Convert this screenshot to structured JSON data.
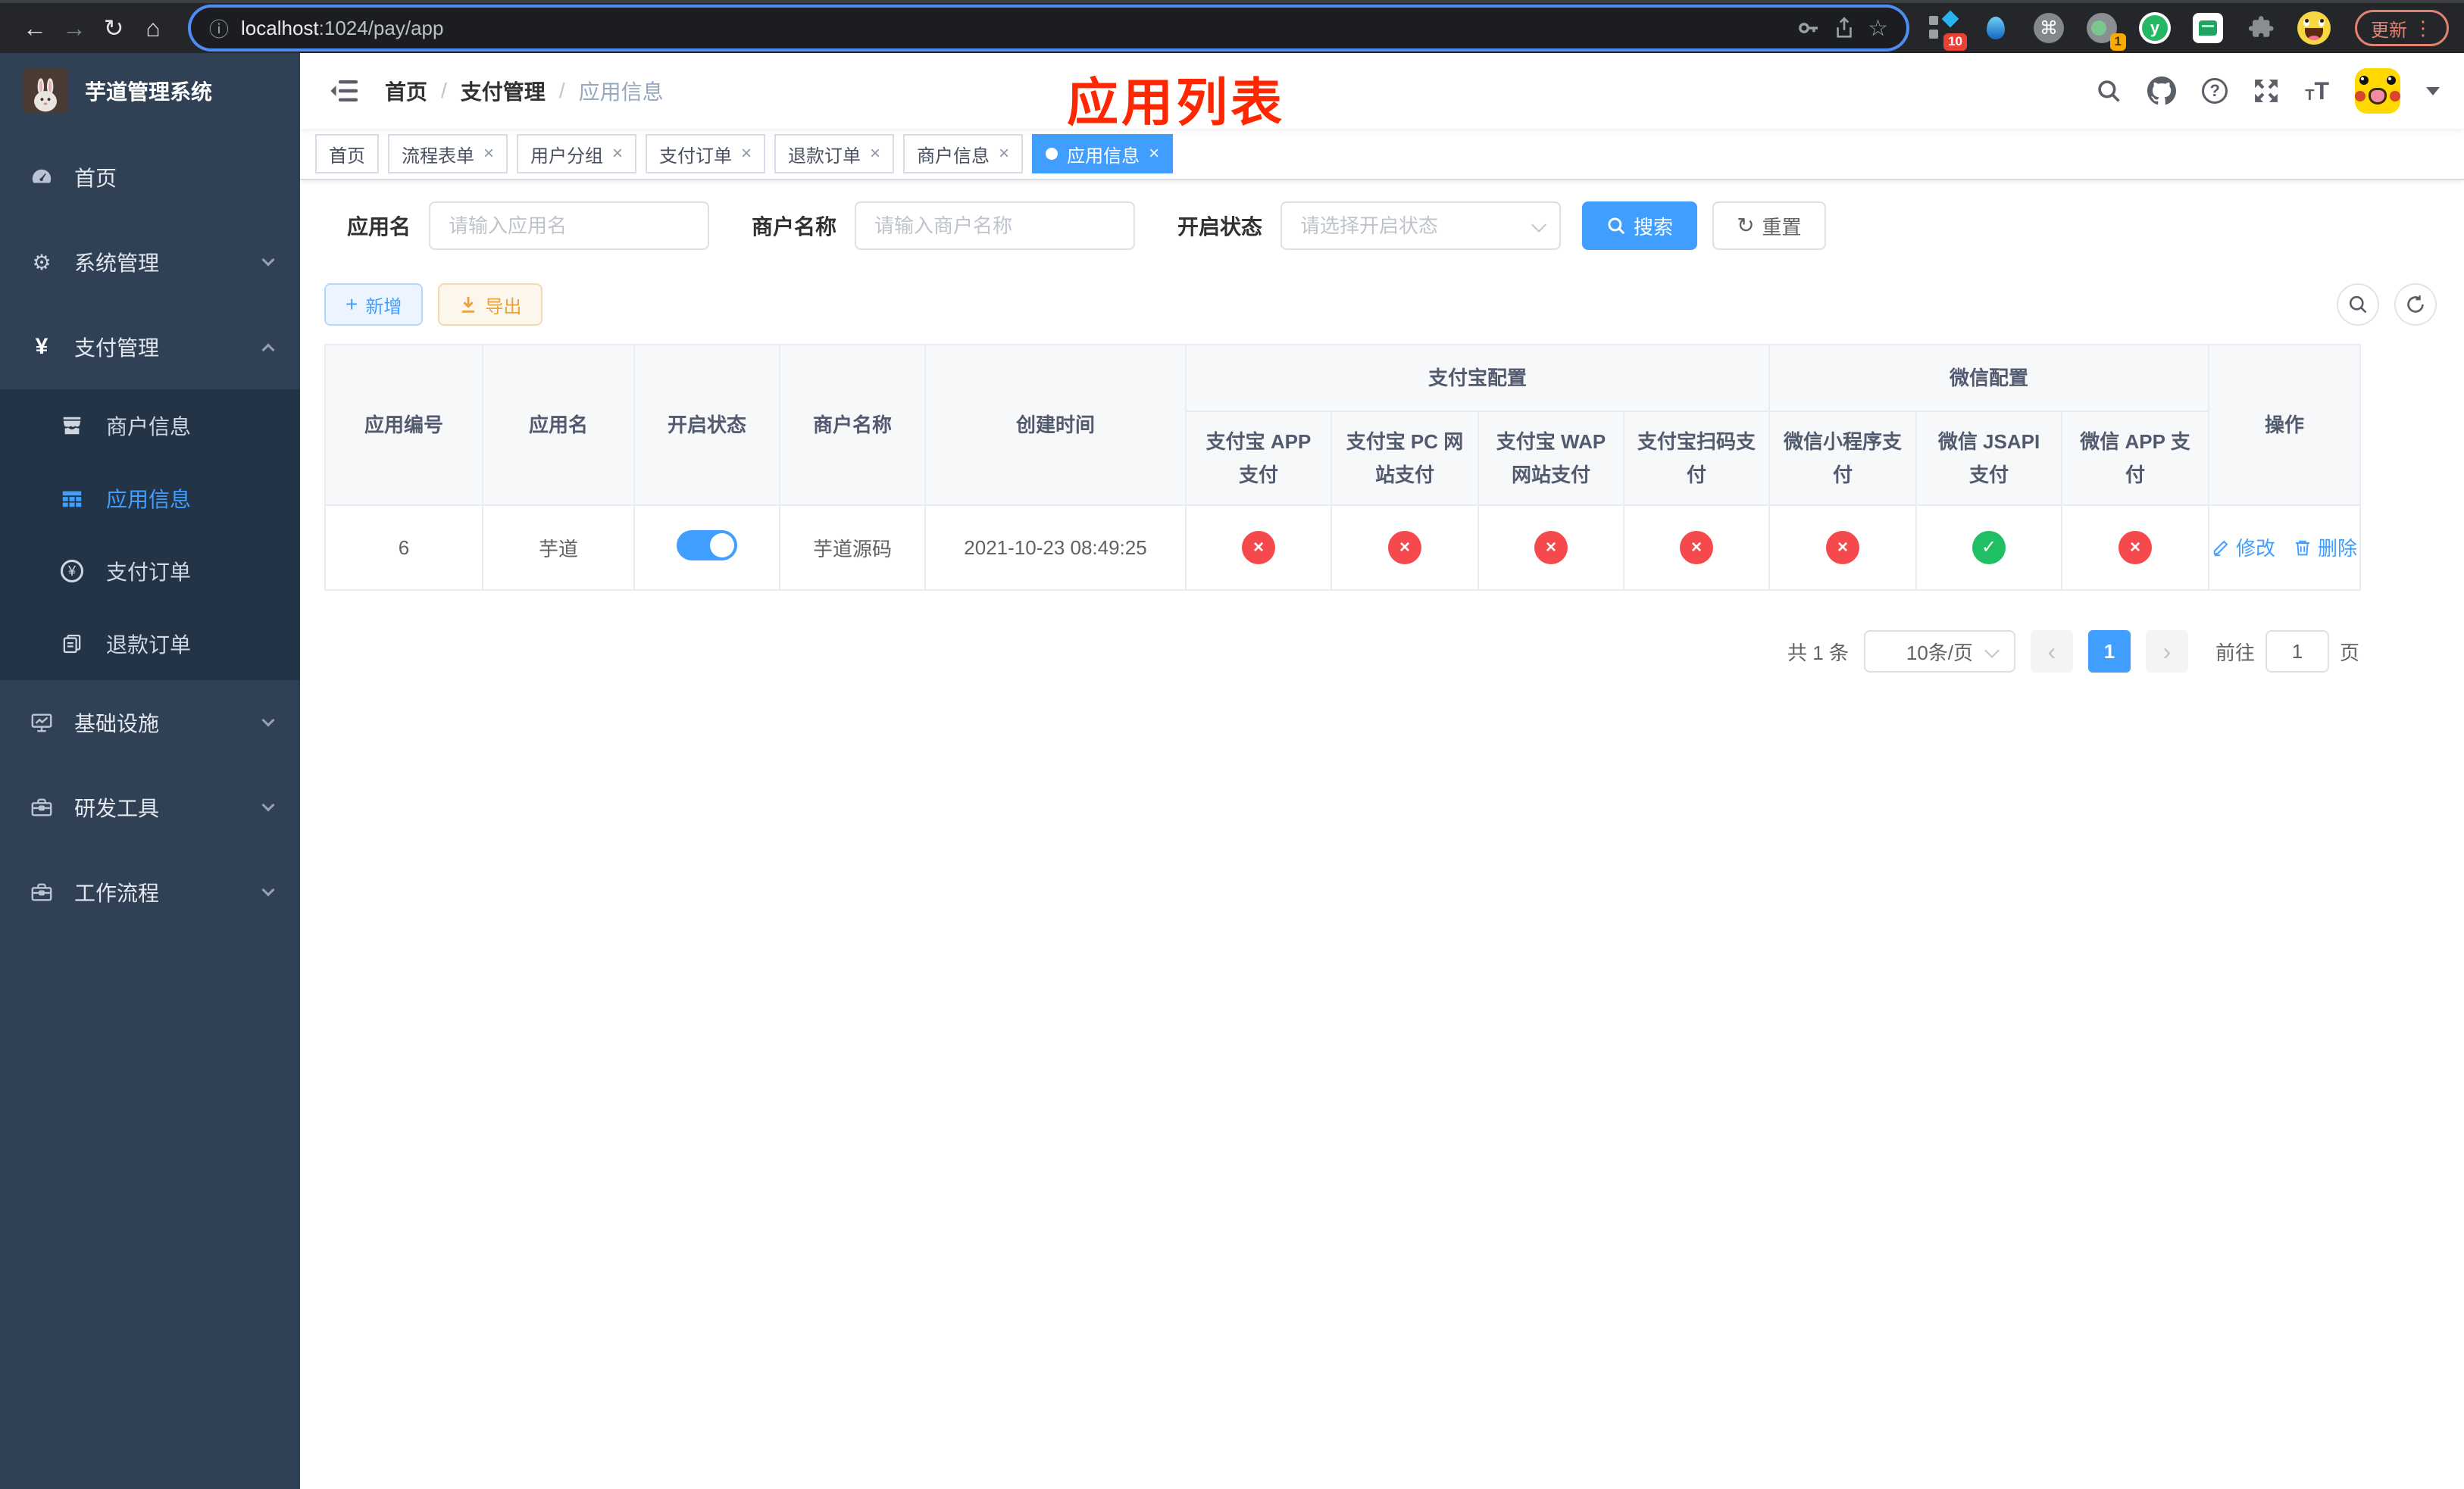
{
  "colors": {
    "accent": "#409eff",
    "danger": "#f5494d",
    "success": "#21bf63",
    "warning": "#e6a23c",
    "annotation_red": "#ff2600",
    "sidebar_bg": "#304156"
  },
  "icons": {
    "back": "←",
    "forward": "→",
    "reload": "↻",
    "home": "⌂",
    "info": "ⓘ",
    "star": "☆",
    "command": "⌘",
    "kebab": "⋮",
    "help": "?",
    "font_small": "T",
    "font_large": "T",
    "check": "✓",
    "cross": "×",
    "prev": "‹",
    "next": "›",
    "yuan": "¥",
    "plus": "+",
    "close": "×"
  },
  "browser": {
    "url_host": "localhost",
    "url_path": ":1024/pay/app",
    "update_label": "更新",
    "ext_badge_count": "10",
    "ext_circle_count": "1",
    "ext_y_label": "y"
  },
  "sidebar": {
    "title": "芋道管理系统",
    "home": "首页",
    "system": "系统管理",
    "payment": "支付管理",
    "merchant_info": "商户信息",
    "app_info": "应用信息",
    "pay_order": "支付订单",
    "refund_order": "退款订单",
    "infrastructure": "基础设施",
    "dev_tools": "研发工具",
    "workflow": "工作流程"
  },
  "breadcrumb": {
    "home": "首页",
    "section": "支付管理",
    "current": "应用信息"
  },
  "annotation": {
    "title": "应用列表"
  },
  "tabs": [
    {
      "label": "首页",
      "closable": false,
      "active": false
    },
    {
      "label": "流程表单",
      "closable": true,
      "active": false
    },
    {
      "label": "用户分组",
      "closable": true,
      "active": false
    },
    {
      "label": "支付订单",
      "closable": true,
      "active": false
    },
    {
      "label": "退款订单",
      "closable": true,
      "active": false
    },
    {
      "label": "商户信息",
      "closable": true,
      "active": false
    },
    {
      "label": "应用信息",
      "closable": true,
      "active": true
    }
  ],
  "filters": {
    "app_name_label": "应用名",
    "app_name_placeholder": "请输入应用名",
    "merchant_label": "商户名称",
    "merchant_placeholder": "请输入商户名称",
    "status_label": "开启状态",
    "status_placeholder": "请选择开启状态",
    "search_label": "搜索",
    "reset_label": "重置"
  },
  "toolbar": {
    "add_label": "新增",
    "export_label": "导出"
  },
  "table": {
    "headers": {
      "app_id": "应用编号",
      "app_name": "应用名",
      "status": "开启状态",
      "merchant_name": "商户名称",
      "create_time": "创建时间",
      "alipay_group": "支付宝配置",
      "wechat_group": "微信配置",
      "alipay_app": "支付宝 APP 支付",
      "alipay_pc": "支付宝 PC 网站支付",
      "alipay_wap": "支付宝 WAP 网站支付",
      "alipay_qr": "支付宝扫码支付",
      "wechat_lite": "微信小程序支付",
      "wechat_jsapi": "微信 JSAPI 支付",
      "wechat_app": "微信 APP 支付",
      "actions": "操作"
    },
    "rows": [
      {
        "app_id": "6",
        "app_name": "芋道",
        "status_enabled": true,
        "merchant_name": "芋道源码",
        "create_time": "2021-10-23 08:49:25",
        "channels": {
          "alipay_app": false,
          "alipay_pc": false,
          "alipay_wap": false,
          "alipay_qr": false,
          "wechat_lite": false,
          "wechat_jsapi": true,
          "wechat_app": false
        },
        "edit_label": "修改",
        "delete_label": "删除"
      }
    ]
  },
  "pagination": {
    "total_text": "共 1 条",
    "page_size_text": "10条/页",
    "current_page": "1",
    "goto_label": "前往",
    "goto_value": "1",
    "page_unit": "页"
  }
}
